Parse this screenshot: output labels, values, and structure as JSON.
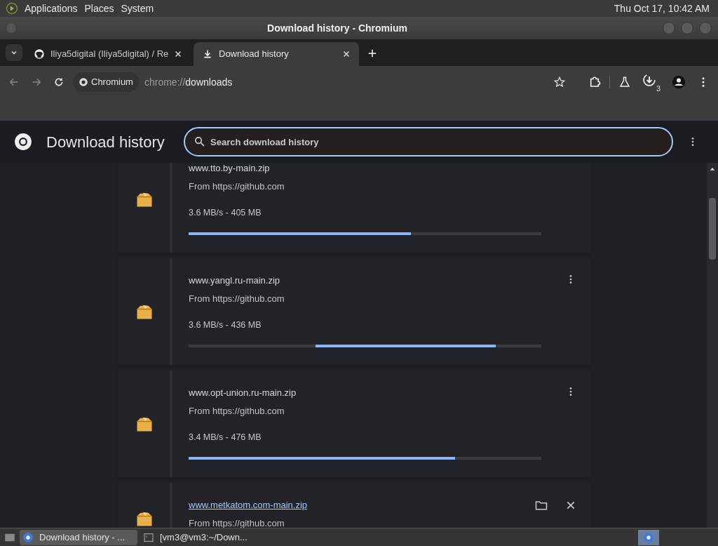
{
  "top_panel": {
    "menus": [
      "Applications",
      "Places",
      "System"
    ],
    "clock": "Thu Oct 17, 10:42 AM"
  },
  "window": {
    "title": "Download history - Chromium"
  },
  "tabs": [
    {
      "label": "Iliya5digital (Iliya5digital) / Re",
      "selected": false,
      "kind": "github"
    },
    {
      "label": "Download history",
      "selected": true,
      "kind": "download"
    }
  ],
  "toolbar": {
    "site_chip": "Chromium",
    "url_prefix": "chrome://",
    "url_host": "downloads",
    "downloads_badge": "3"
  },
  "page": {
    "title": "Download history",
    "search": {
      "placeholder": "Search download history"
    }
  },
  "downloads": [
    {
      "name": "www.tto.by-main.zip",
      "source": "From https://github.com",
      "status": "3.6 MB/s - 405 MB",
      "kind": "progress",
      "level": 0.63
    },
    {
      "name": "www.yangl.ru-main.zip",
      "source": "From https://github.com",
      "status": "3.6 MB/s - 436 MB",
      "kind": "indeterminate"
    },
    {
      "name": "www.opt-union.ru-main.zip",
      "source": "From https://github.com",
      "status": "3.4 MB/s - 476 MB",
      "kind": "progress",
      "level": 0.755
    },
    {
      "name": "www.metkatom.com-main.zip",
      "source": "From https://github.com",
      "kind": "complete"
    }
  ],
  "taskbar": {
    "items": [
      {
        "label": "Download history - ...",
        "selected": true,
        "kind": "browser"
      },
      {
        "label": "[vm3@vm3:~/Down...",
        "selected": false,
        "kind": "terminal"
      }
    ]
  }
}
